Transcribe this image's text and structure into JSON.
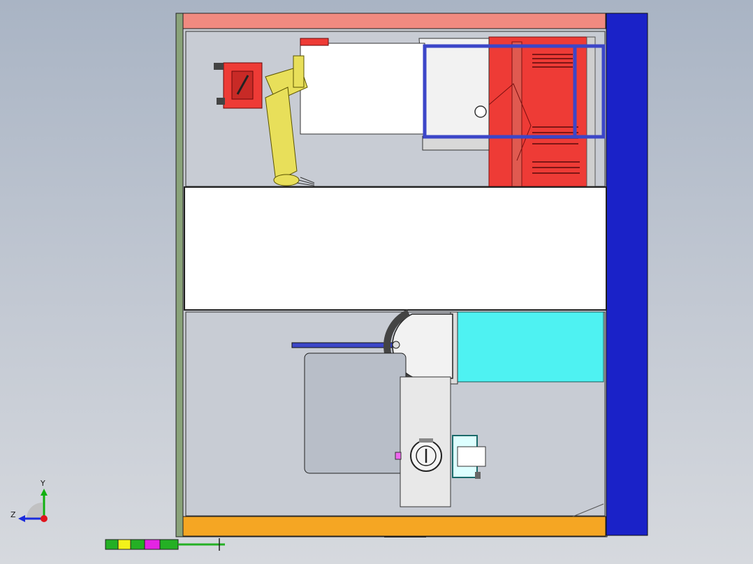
{
  "viewport": {
    "background_top": "#a9b4c4",
    "background_bottom": "#d6d9de"
  },
  "model": {
    "colors": {
      "frame_left": "#8aa37a",
      "top_bar": "#f08a80",
      "right_wall": "#1a22c8",
      "bottom_bar": "#f5a623",
      "robot": "#e8df5a",
      "cabinet": "#ee3b36",
      "guard_rail": "#3c46c8",
      "conveyor": "#4ef2f2",
      "inner_panel": "#c8ccd4"
    },
    "icons": [
      "robot-arm-icon",
      "gripper-icon",
      "bearing-icon"
    ]
  },
  "triad": {
    "y_label": "Y",
    "z_label": "Z",
    "colors": {
      "y": "#11b011",
      "z": "#1a2adc",
      "origin": "#e0141c"
    }
  },
  "scale_bar": {
    "segment_colors": [
      "#24b024",
      "#f2f21a",
      "#24b024",
      "#e424e4",
      "#24b024"
    ]
  }
}
